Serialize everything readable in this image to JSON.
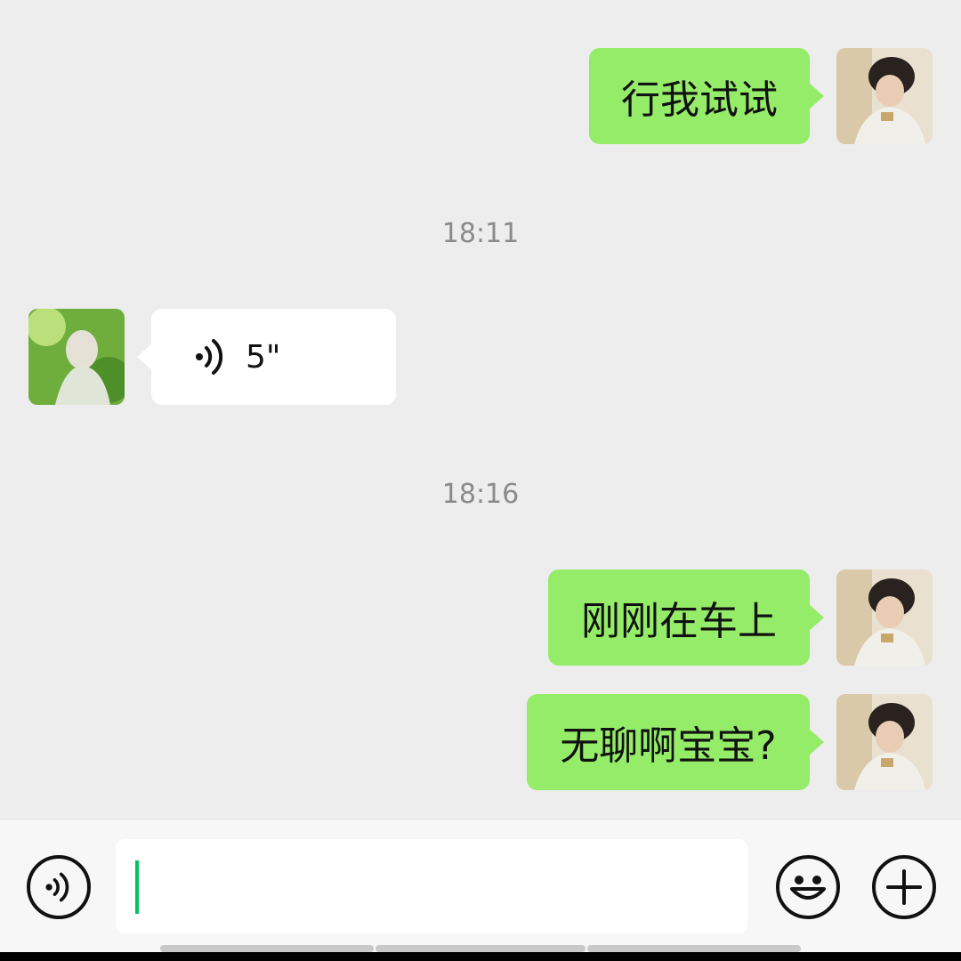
{
  "messages": [
    {
      "side": "out",
      "kind": "text",
      "text": "行我试试"
    },
    {
      "kind": "time",
      "text": "18:11"
    },
    {
      "side": "in",
      "kind": "voice",
      "duration": "5\""
    },
    {
      "kind": "time",
      "text": "18:16"
    },
    {
      "side": "out",
      "kind": "text",
      "text": "刚刚在车上"
    },
    {
      "side": "out",
      "kind": "text",
      "text": "无聊啊宝宝?"
    }
  ],
  "input": {
    "value": ""
  },
  "icons": {
    "voice_toggle": "voice-mode-icon",
    "emoji": "emoji-icon",
    "more": "plus-icon",
    "voice_message": "voice-wave-icon"
  },
  "colors": {
    "outgoing_bubble": "#95ec69",
    "incoming_bubble": "#ffffff",
    "background": "#ededed",
    "caret": "#07c160"
  }
}
